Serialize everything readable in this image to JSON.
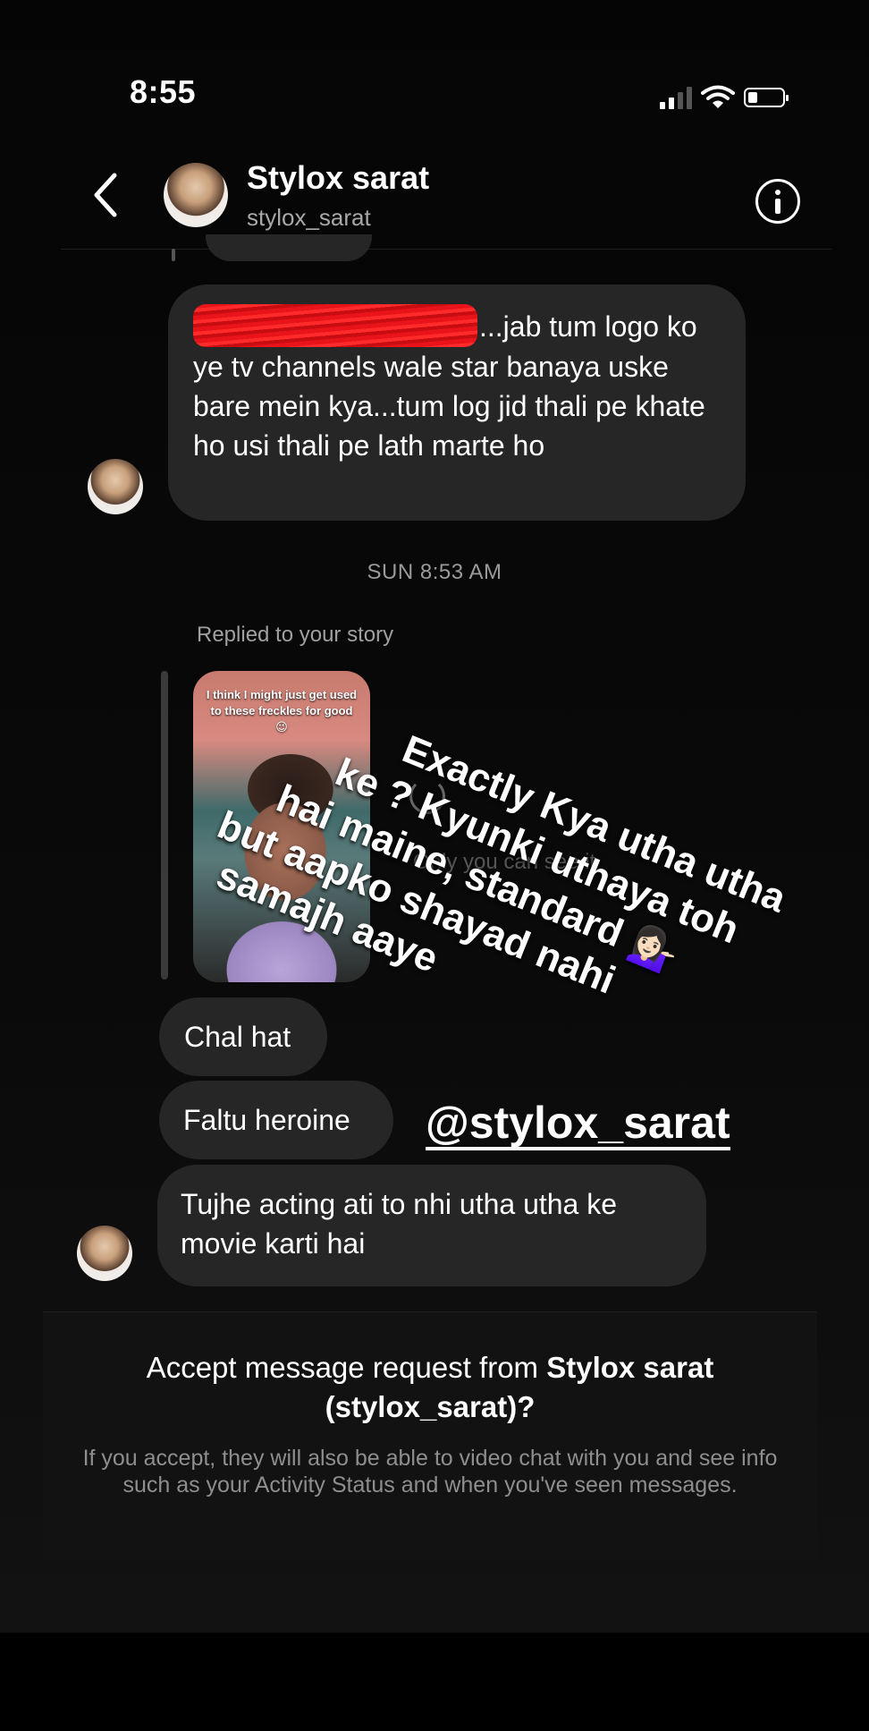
{
  "status_bar": {
    "time": "8:55"
  },
  "header": {
    "name": "Stylox sarat",
    "username": "stylox_sarat"
  },
  "messages": [
    {
      "text_before_redaction": "",
      "text": "...jab tum logo ko ye tv channels wale star banaya uske bare mein kya...tum log jid thali pe khate ho usi thali pe lath marte ho"
    },
    {
      "text": "Chal hat"
    },
    {
      "text": "Faltu heroine"
    },
    {
      "text": "Tujhe acting ati to nhi utha utha ke movie karti hai"
    }
  ],
  "timestamp": "SUN 8:53 AM",
  "story_reply": {
    "label": "Replied to your story",
    "story_caption": "I think I might just get used to these freckles for good 😉",
    "visibility_note": "Only you can see it"
  },
  "overlay": {
    "line1": "Exactly Kya utha utha",
    "line2": "ke ? Kyunki uthaya toh",
    "line3": "hai maine, standard 💁🏻‍♀️",
    "line4": "but aapko shayad nahi",
    "line5": "samajh aaye",
    "mention": "@stylox_sarat"
  },
  "request": {
    "prompt_prefix": "Accept message request from ",
    "prompt_name": "Stylox sarat",
    "prompt_handle": "(stylox_sarat)?",
    "explanation": "If you accept, they will also be able to video chat with you and see info such as your Activity Status and when you've seen messages."
  },
  "icons": {
    "back": "chevron-left-icon",
    "info": "info-icon",
    "signal": "cellular-signal-icon",
    "wifi": "wifi-icon",
    "battery": "battery-icon"
  },
  "colors": {
    "background": "#000000",
    "bubble": "#262626",
    "secondary_text": "#a8a8a8",
    "redaction": "#ff2a2a"
  }
}
